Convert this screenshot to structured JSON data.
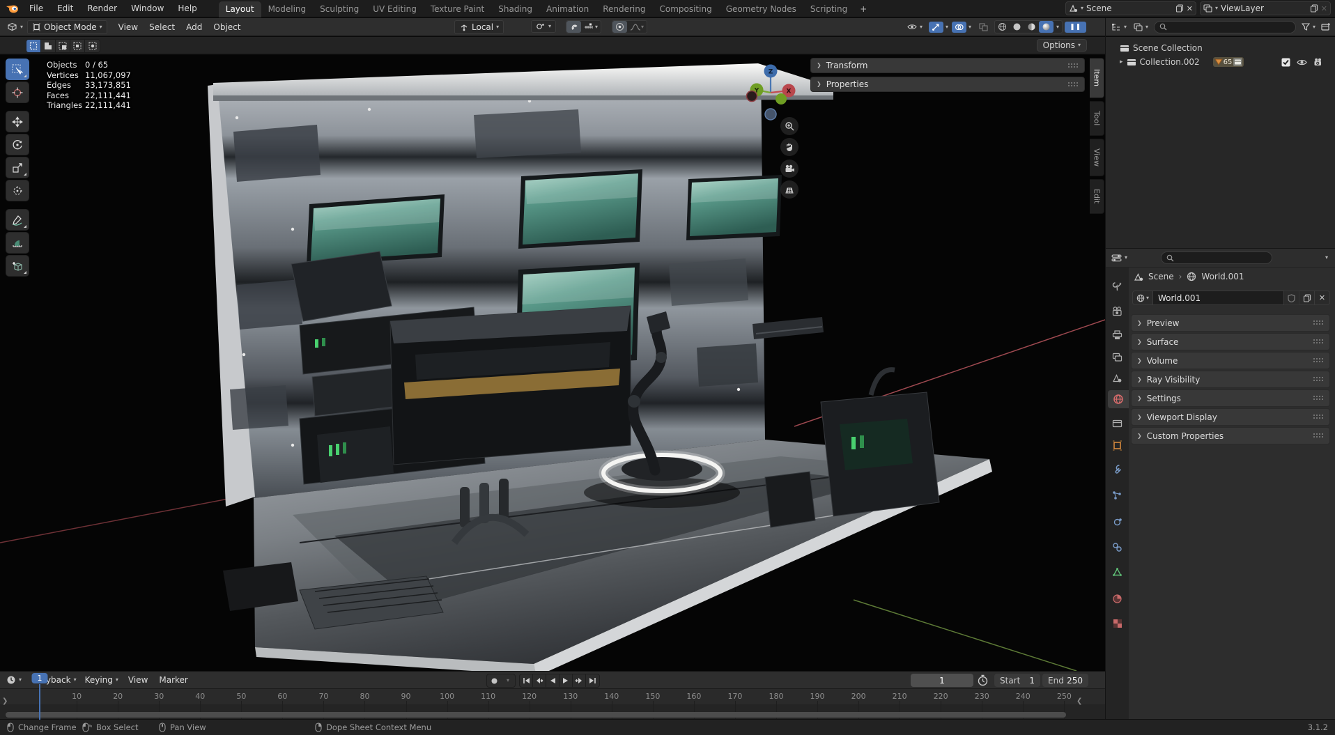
{
  "topbar": {
    "menus": [
      "File",
      "Edit",
      "Render",
      "Window",
      "Help"
    ],
    "workspaces": [
      "Layout",
      "Modeling",
      "Sculpting",
      "UV Editing",
      "Texture Paint",
      "Shading",
      "Animation",
      "Rendering",
      "Compositing",
      "Geometry Nodes",
      "Scripting"
    ],
    "add_workspace_label": "+",
    "scene_selector": {
      "value": "Scene"
    },
    "view_layer_selector": {
      "value": "ViewLayer"
    }
  },
  "viewport_header": {
    "mode": "Object Mode",
    "menus": [
      "View",
      "Select",
      "Add",
      "Object"
    ],
    "transform_orientation": "Local",
    "options_label": "Options"
  },
  "viewport": {
    "stats": {
      "rows": [
        {
          "label": "Objects",
          "value": "0 / 65"
        },
        {
          "label": "Vertices",
          "value": "11,067,097"
        },
        {
          "label": "Edges",
          "value": "33,173,851"
        },
        {
          "label": "Faces",
          "value": "22,111,441"
        },
        {
          "label": "Triangles",
          "value": "22,111,441"
        }
      ]
    },
    "axis_gizmo": {
      "x": "X",
      "y": "Y",
      "z": "Z"
    },
    "sidebar": {
      "panels": [
        "Transform",
        "Properties"
      ],
      "tabs": [
        "Item",
        "Tool",
        "View",
        "Edit"
      ]
    }
  },
  "outliner": {
    "scene_collection": "Scene Collection",
    "collection": {
      "name": "Collection.002",
      "count": "65"
    }
  },
  "properties": {
    "breadcrumb": {
      "scene": "Scene",
      "separator": "›",
      "world": "World.001"
    },
    "datablock": {
      "name": "World.001"
    },
    "panels": [
      "Preview",
      "Surface",
      "Volume",
      "Ray Visibility",
      "Settings",
      "Viewport Display",
      "Custom Properties"
    ]
  },
  "timeline": {
    "menus": [
      "Playback",
      "Keying",
      "View",
      "Marker"
    ],
    "current_frame": "1",
    "frame_field_value": "1",
    "start": {
      "label": "Start",
      "value": "1"
    },
    "end": {
      "label": "End",
      "value": "250"
    },
    "ticks": [
      1,
      10,
      20,
      30,
      40,
      50,
      60,
      70,
      80,
      90,
      100,
      110,
      120,
      130,
      140,
      150,
      160,
      170,
      180,
      190,
      200,
      210,
      220,
      230,
      240,
      250
    ]
  },
  "status_bar": {
    "hints": [
      {
        "button": "left-drag",
        "label": "Change Frame"
      },
      {
        "button": "left",
        "label": "Box Select"
      },
      {
        "button": "middle",
        "label": "Pan View"
      },
      {
        "button": "right",
        "label": "Dope Sheet Context Menu"
      }
    ],
    "version": "3.1.2"
  },
  "colors": {
    "accent": "#4772b3",
    "axis_x": "#a34046",
    "axis_y": "#5d7a36",
    "axis_z": "#3d6cab",
    "screen_teal": "#57958a"
  },
  "icons": {
    "chevron-down": "▾",
    "disclosure-right": "❯",
    "disclosure-tri": "▸",
    "collapse-left": "❮",
    "collapse-right": "❯",
    "play": "▶",
    "pause": "❚❚",
    "record": "●",
    "close": "✕",
    "breadcrumb-sep": "›"
  }
}
